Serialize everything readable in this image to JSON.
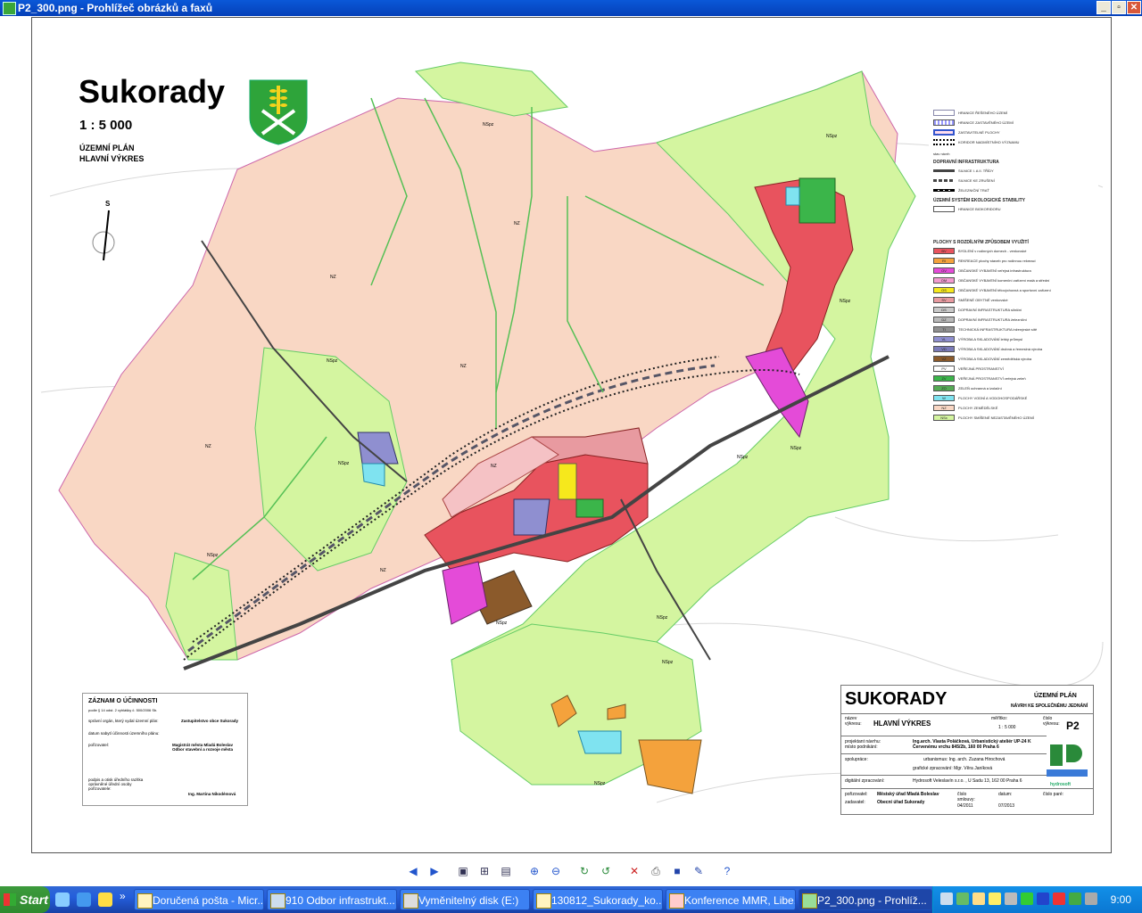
{
  "window": {
    "title": "P2_300.png - Prohlížeč obrázků a faxů",
    "buttons": {
      "minimize": "_",
      "maximize": "▫",
      "close": "✕"
    }
  },
  "map": {
    "title": "Sukorady",
    "scale": "1 : 5 000",
    "subtitle1": "ÚZEMNÍ PLÁN",
    "subtitle2": "HLAVNÍ VÝKRES",
    "north": "S",
    "labels": [
      "NZ",
      "NZ",
      "NZ",
      "NZ",
      "NZ",
      "NZ",
      "NSpz",
      "NSpz",
      "NSpz",
      "NSpz",
      "NSpz",
      "NSpz",
      "NSpz",
      "NSpz",
      "NSpz",
      "NSpz",
      "NSpz",
      "NSpz"
    ],
    "legend": {
      "lines": [
        {
          "text": "HRANICE ŘEŠENÉHO ÚZEMÍ"
        },
        {
          "text": "HRANICE ZASTAVĚNÉHO ÚZEMÍ"
        },
        {
          "text": "ZASTAVITELNÉ PLOCHY"
        },
        {
          "text": "KORIDOR NADMÍSTNÍHO VÝZNAMU"
        }
      ],
      "status_head": "stav     návrh",
      "transport_head": "DOPRAVNÍ INFRASTRUKTURA",
      "transport": [
        {
          "text": "SILNICE I. A II. TŘÍDY"
        },
        {
          "text": "SILNICE KE ZRUŠENÍ"
        },
        {
          "text": "ŽELEZNIČNÍ TRAŤ"
        }
      ],
      "uses_head": "ÚZEMNÍ SYSTÉM EKOLOGICKÉ STABILITY",
      "uses_row": "HRANICE BIOKORIDORU",
      "plochy_head": "PLOCHY S ROZDÍLNÝM ZPŮSOBEM VYUŽITÍ",
      "items": [
        {
          "code": "BV",
          "color": "#e8535e",
          "text": "BYDLENÍ v rodinných domech - venkovské"
        },
        {
          "code": "RI",
          "color": "#f4a23c",
          "text": "REKREACE plochy staveb pro rodinnou rekreaci"
        },
        {
          "code": "OV",
          "color": "#e44bd8",
          "text": "OBČANSKÉ VYBAVENÍ veřejná infrastruktura"
        },
        {
          "code": "OM",
          "color": "#f29ad0",
          "text": "OBČANSKÉ VYBAVENÍ komerční zařízení malá a střední"
        },
        {
          "code": "OS",
          "color": "#f6e81c",
          "text": "OBČANSKÉ VYBAVENÍ tělovýchovná a sportovní zařízení"
        },
        {
          "code": "SV",
          "color": "#e89aa0",
          "text": "SMÍŠENÉ OBYTNÉ venkovské"
        },
        {
          "code": "DS",
          "color": "#c8c8c8",
          "text": "DOPRAVNÍ INFRASTRUKTURA silniční"
        },
        {
          "code": "DZ",
          "color": "#b9b9b9",
          "text": "DOPRAVNÍ INFRASTRUKTURA železniční"
        },
        {
          "code": "TI",
          "color": "#909090",
          "text": "TECHNICKÁ INFRASTRUKTURA inženýrské sítě"
        },
        {
          "code": "VL",
          "color": "#8f8fd0",
          "text": "VÝROBA A SKLADOVÁNÍ lehký průmysl"
        },
        {
          "code": "VD",
          "color": "#7a7ab8",
          "text": "VÝROBA A SKLADOVÁNÍ drobná a řemeslná výroba"
        },
        {
          "code": "VZ",
          "color": "#8b5a2b",
          "text": "VÝROBA A SKLADOVÁNÍ zemědělská výroba"
        },
        {
          "code": "PV",
          "color": "#ffffff",
          "text": "VEŘEJNÁ PROSTRANSTVÍ"
        },
        {
          "code": "ZV",
          "color": "#3bb54a",
          "text": "VEŘEJNÁ PROSTRANSTVÍ veřejná zeleň"
        },
        {
          "code": "ZO",
          "color": "#55aa55",
          "text": "ZELEŇ ochranná a izolační"
        },
        {
          "code": "W",
          "color": "#7fe3f0",
          "text": "PLOCHY VODNÍ A VODOHOSPODÁŘSKÉ"
        },
        {
          "code": "NZ",
          "color": "#f9d7c4",
          "text": "PLOCHY ZEMĚDĚLSKÉ"
        },
        {
          "code": "NSx",
          "color": "#d4f5a0",
          "text": "PLOCHY SMÍŠENÉ NEZASTAVĚNÉHO ÚZEMÍ"
        }
      ]
    },
    "record": {
      "title": "ZÁZNAM O ÚČINNOSTI",
      "sub": "podle § 14 odst. 2 vyhlášky č. 500/2006 Sb.",
      "rows": [
        {
          "label": "správní orgán, který vydal územní plán:",
          "value": "Zastupitelstvo obce Sukorady"
        },
        {
          "label": "datum nabytí účinnosti územního plánu:",
          "value": ""
        },
        {
          "label": "pořizovatel:",
          "value": "Magistrát města Mladá Boleslav Odbor stavební a rozvoje města"
        },
        {
          "label": "podpis a otisk úředního razítka oprávněné úřední osoby pořizovatele:",
          "value": "Ing. Martina Nikodémová"
        }
      ]
    },
    "titleblock": {
      "name": "SUKORADY",
      "plan": "ÚZEMNÍ PLÁN",
      "stage": "NÁVRH KE SPOLEČNÉMU JEDNÁNÍ",
      "nazev_label": "název výkresu:",
      "nazev": "HLAVNÍ VÝKRES",
      "meritko_label": "měřítko:",
      "meritko": "1 : 5 000",
      "cislo_label": "číslo výkresu:",
      "cislo": "P2",
      "projektant_label": "projektant návrhu: místo podnikání:",
      "projektant": "Ing.arch. Vlasta Poláčková, Urbanistický ateliér UP-24 K Červenému vrchu 845/2b, 160 00 Praha 6",
      "spoluprace_label": "spolupráce:",
      "spoluprace1": "urbanismus: Ing. arch. Zuzana Hirochová",
      "spoluprace2": "grafické zpracování: Mgr. Věra Janíková",
      "digital_label": "digitální zpracování:",
      "digital": "Hydrosoft Veleslavín s.r.o. , U Sadu 13, 162 00 Praha 6",
      "porizovatel_label": "pořizovatel:",
      "porizovatel": "Městský úřad Mladá Boleslav",
      "zadavatel_label": "zadavatel:",
      "zadavatel": "Obecní úřad Sukorady",
      "smlouva_label": "číslo smlouvy:",
      "smlouva": "04/2011",
      "datum_label": "datum:",
      "datum": "07/2013",
      "cislo_paré": "číslo paré:",
      "logo_text": "hydrosoft"
    }
  },
  "toolbar": {
    "buttons": [
      "prev-image",
      "next-image",
      "best-fit",
      "actual-size",
      "slideshow",
      "zoom-in",
      "zoom-out",
      "rotate-clockwise",
      "rotate-counterclockwise",
      "delete",
      "print",
      "save",
      "edit",
      "help"
    ]
  },
  "taskbar": {
    "start": "Start",
    "items": [
      {
        "label": "Doručená pošta - Micr..."
      },
      {
        "label": "910 Odbor infrastrukt..."
      },
      {
        "label": "Vyměnitelný disk (E:)"
      },
      {
        "label": "130812_Sukorady_ko..."
      },
      {
        "label": "Konference MMR, Libe..."
      },
      {
        "label": "P2_300.png - Prohlíž..."
      }
    ],
    "clock": "9:00"
  }
}
